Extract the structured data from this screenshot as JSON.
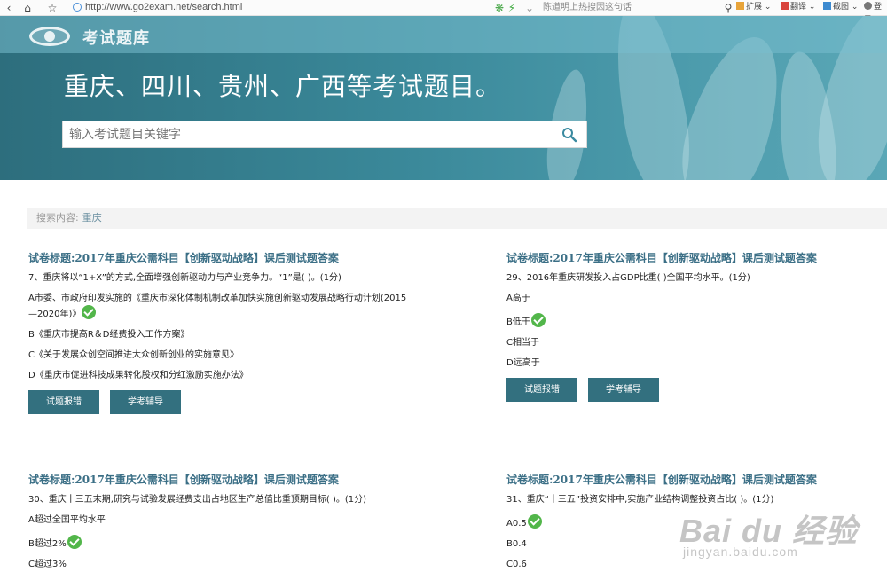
{
  "browser": {
    "url": "http://www.go2exam.net/search.html",
    "search_hint": "陈道明上热搜因这句话",
    "ext_expand": "扩展",
    "ext_translate": "翻译",
    "ext_screenshot": "截图",
    "ext_login": "登录"
  },
  "hero": {
    "logo_text": "考试题库",
    "title": "重庆、四川、贵州、广西等考试题目。",
    "search_placeholder": "输入考试题目关键字"
  },
  "filter": {
    "label": "搜索内容:",
    "keyword": "重庆"
  },
  "buttons": {
    "report": "试题报错",
    "tutor": "学考辅导"
  },
  "cards": [
    {
      "title": "试卷标题:2017年重庆公需科目【创新驱动战略】课后测试题答案",
      "question": "7、重庆将以“1+X”的方式,全面增强创新驱动力与产业竞争力。“1”是( )。(1分)",
      "options": [
        "A市委、市政府印发实施的《重庆市深化体制机制改革加快实施创新驱动发展战略行动计划(2015—2020年)》",
        "B《重庆市提高R＆D经费投入工作方案》",
        "C《关于发展众创空间推进大众创新创业的实施意见》",
        "D《重庆市促进科技成果转化股权和分红激励实施办法》"
      ],
      "correct": 0
    },
    {
      "title": "试卷标题:2017年重庆公需科目【创新驱动战略】课后测试题答案",
      "question": "29、2016年重庆研发投入占GDP比重( )全国平均水平。(1分)",
      "options": [
        "A高于",
        "B低于",
        "C相当于",
        "D远高于"
      ],
      "correct": 1
    },
    {
      "title": "试卷标题:2017年重庆公需科目【创新驱动战略】课后测试题答案",
      "question": "30、重庆十三五末期,研究与试验发展经费支出占地区生产总值比重预期目标( )。(1分)",
      "options": [
        "A超过全国平均水平",
        "B超过2%",
        "C超过3%"
      ],
      "correct": 1
    },
    {
      "title": "试卷标题:2017年重庆公需科目【创新驱动战略】课后测试题答案",
      "question": "31、重庆“十三五”投资安排中,实施产业结构调整投资占比( )。(1分)",
      "options": [
        "A0.5",
        "B0.4",
        "C0.6"
      ],
      "correct": 0
    }
  ],
  "watermark": {
    "big": "Bai du 经验",
    "small": "jingyan.baidu.com"
  }
}
